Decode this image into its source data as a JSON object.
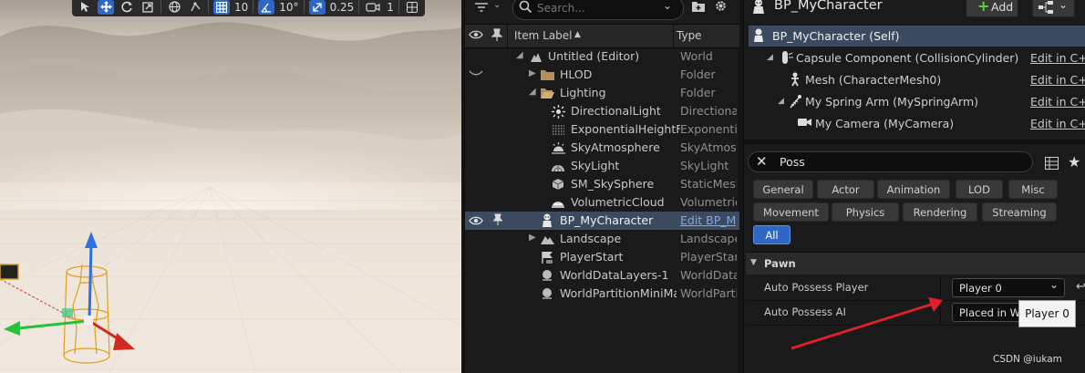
{
  "viewport": {
    "toolbar": {
      "grid_snap_value": "10",
      "rotation_snap_value": "10°",
      "scale_snap_value": "0.25",
      "camera_speed_value": "1"
    }
  },
  "outliner": {
    "search_placeholder": "Search...",
    "columns": {
      "label": "Item Label",
      "sort_indicator": "▲",
      "type": "Type"
    },
    "rows": [
      {
        "label": "Untitled (Editor)",
        "type": "World"
      },
      {
        "label": "HLOD",
        "type": "Folder"
      },
      {
        "label": "Lighting",
        "type": "Folder"
      },
      {
        "label": "DirectionalLight",
        "type": "DirectionalLight"
      },
      {
        "label": "ExponentialHeightFog",
        "type": "ExponentialHeightFog"
      },
      {
        "label": "SkyAtmosphere",
        "type": "SkyAtmosphere"
      },
      {
        "label": "SkyLight",
        "type": "SkyLight"
      },
      {
        "label": "SM_SkySphere",
        "type": "StaticMeshActor"
      },
      {
        "label": "VolumetricCloud",
        "type": "VolumetricCloud"
      },
      {
        "label": "BP_MyCharacter",
        "type": "Edit BP_MyCharacter"
      },
      {
        "label": "Landscape",
        "type": "Landscape"
      },
      {
        "label": "PlayerStart",
        "type": "PlayerStart"
      },
      {
        "label": "WorldDataLayers-1",
        "type": "WorldDataLayers"
      },
      {
        "label": "WorldPartitionMiniMap",
        "type": "WorldPartitionMiniMap"
      }
    ]
  },
  "details": {
    "title": "BP_MyCharacter",
    "add_label": "Add",
    "components": [
      {
        "label": "BP_MyCharacter (Self)",
        "edit": ""
      },
      {
        "label": "Capsule Component (CollisionCylinder)",
        "edit": "Edit in C++"
      },
      {
        "label": "Mesh (CharacterMesh0)",
        "edit": "Edit in C++"
      },
      {
        "label": "My Spring Arm (MySpringArm)",
        "edit": "Edit in C++"
      },
      {
        "label": "My Camera (MyCamera)",
        "edit": "Edit in C++"
      }
    ],
    "search_value": "Poss",
    "categories_row1": [
      "General",
      "Actor",
      "Animation",
      "LOD",
      "Misc"
    ],
    "categories_row2": [
      "Movement",
      "Physics",
      "Rendering",
      "Streaming"
    ],
    "category_all": "All",
    "section": "Pawn",
    "properties": [
      {
        "name": "Auto Possess Player",
        "value": "Player 0"
      },
      {
        "name": "Auto Possess AI",
        "value": "Placed in World"
      }
    ],
    "tooltip": "Player 0",
    "watermark": "CSDN @iukam"
  },
  "colors": {
    "accent": "#2e67c4",
    "selection": "#3b4a5e",
    "arrow_red": "#e0202a"
  }
}
